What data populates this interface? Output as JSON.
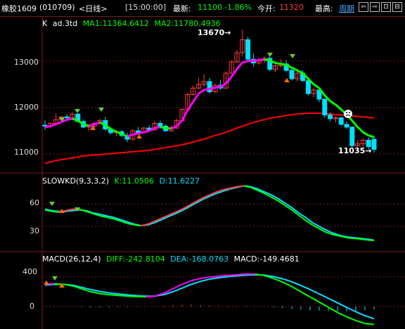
{
  "header": {
    "symbol": "橡胶1609",
    "code": "(010709)",
    "period": "<日线>",
    "time": "[15:00:00]",
    "latest_label": "最新:",
    "latest_value": "11100",
    "change_pct": "-1.86%",
    "open_label": "今开:",
    "open_value": "11320",
    "high_label": "最高:",
    "cycle_link": "周期",
    "buttons": [
      "⇦",
      "⇨",
      "⊡",
      "⊟"
    ]
  },
  "colors": {
    "up": "#ff3b3b",
    "down": "#00e0ff",
    "ma1": "#00ff00",
    "ma2": "#ff0000",
    "accent_magenta": "#ff00ff",
    "divider": "#7a1a1a"
  },
  "main_panel": {
    "label_k": "K",
    "label_ad": "ad.3td",
    "ma1": "MA1:11364.6412",
    "ma2": "MA2:11780.4936",
    "high_annotation": "13670",
    "low_annotation": "11035",
    "y_ticks": [
      "13000",
      "12000",
      "11000"
    ]
  },
  "kd_panel": {
    "label": "SLOWKD(9,3,3,2)",
    "k": "K:11.0506",
    "d": "D:11.6227",
    "y_ticks": [
      "60",
      "30"
    ]
  },
  "macd_panel": {
    "label": "MACD(26,12,4)",
    "diff": "DIFF:-242.8104",
    "dea": "DEA:-168.0763",
    "macd": "MACD:-149.4681",
    "y_ticks": [
      "400",
      "0"
    ]
  },
  "chart_data": {
    "type": "line",
    "candles": [
      [
        11620,
        11720,
        11520,
        11600
      ],
      [
        11600,
        11680,
        11560,
        11660
      ],
      [
        11660,
        11880,
        11640,
        11740
      ],
      [
        11740,
        11820,
        11700,
        11800
      ],
      [
        11800,
        11860,
        11720,
        11780
      ],
      [
        11780,
        11900,
        11760,
        11860
      ],
      [
        11860,
        11880,
        11680,
        11700
      ],
      [
        11700,
        11740,
        11560,
        11580
      ],
      [
        11580,
        11640,
        11500,
        11600
      ],
      [
        11600,
        11700,
        11560,
        11660
      ],
      [
        11660,
        11760,
        11640,
        11720
      ],
      [
        11720,
        11800,
        11500,
        11540
      ],
      [
        11540,
        11580,
        11420,
        11460
      ],
      [
        11460,
        11520,
        11380,
        11480
      ],
      [
        11480,
        11520,
        11360,
        11400
      ],
      [
        11400,
        11460,
        11260,
        11320
      ],
      [
        11320,
        11540,
        11300,
        11500
      ],
      [
        11500,
        11580,
        11420,
        11460
      ],
      [
        11460,
        11580,
        11440,
        11560
      ],
      [
        11560,
        11620,
        11500,
        11520
      ],
      [
        11520,
        11700,
        11500,
        11660
      ],
      [
        11660,
        11720,
        11560,
        11600
      ],
      [
        11600,
        11640,
        11480,
        11500
      ],
      [
        11500,
        11620,
        11480,
        11560
      ],
      [
        11560,
        11760,
        11540,
        11720
      ],
      [
        11720,
        11980,
        11700,
        11960
      ],
      [
        11960,
        12320,
        11940,
        12280
      ],
      [
        12280,
        12480,
        12260,
        12420
      ],
      [
        12420,
        12640,
        12380,
        12500
      ],
      [
        12500,
        12720,
        12440,
        12560
      ],
      [
        12560,
        12640,
        12300,
        12340
      ],
      [
        12340,
        12520,
        12320,
        12480
      ],
      [
        12480,
        12600,
        12380,
        12420
      ],
      [
        12420,
        12780,
        12400,
        12740
      ],
      [
        12740,
        13020,
        12720,
        12980
      ],
      [
        12980,
        13240,
        12960,
        13180
      ],
      [
        13180,
        13670,
        13100,
        13460
      ],
      [
        13460,
        13520,
        12980,
        13040
      ],
      [
        13040,
        13160,
        12880,
        12960
      ],
      [
        12960,
        13080,
        12920,
        13020
      ],
      [
        13020,
        13100,
        12960,
        13060
      ],
      [
        13060,
        13100,
        12780,
        12820
      ],
      [
        12820,
        12960,
        12760,
        12900
      ],
      [
        12900,
        13040,
        12860,
        12940
      ],
      [
        12940,
        13020,
        12760,
        12800
      ],
      [
        12800,
        12860,
        12580,
        12620
      ],
      [
        12620,
        12780,
        12560,
        12740
      ],
      [
        12740,
        12800,
        12560,
        12580
      ],
      [
        12580,
        12620,
        12260,
        12300
      ],
      [
        12300,
        12440,
        12220,
        12380
      ],
      [
        12380,
        12420,
        12120,
        12180
      ],
      [
        12180,
        12200,
        11780,
        11840
      ],
      [
        11840,
        11900,
        11700,
        11760
      ],
      [
        11760,
        11820,
        11680,
        11780
      ],
      [
        11780,
        11800,
        11600,
        11640
      ],
      [
        11640,
        11700,
        11540,
        11580
      ],
      [
        11580,
        11600,
        11120,
        11180
      ],
      [
        11180,
        11300,
        11060,
        11220
      ],
      [
        11220,
        11340,
        11160,
        11300
      ],
      [
        11300,
        11360,
        11100,
        11160
      ],
      [
        11320,
        11380,
        11035,
        11100
      ]
    ],
    "ma1": [
      11580,
      11600,
      11640,
      11690,
      11740,
      11760,
      11720,
      11640,
      11610,
      11640,
      11680,
      11620,
      11540,
      11480,
      11430,
      11380,
      11420,
      11440,
      11470,
      11500,
      11560,
      11580,
      11560,
      11550,
      11600,
      11720,
      11940,
      12120,
      12300,
      12380,
      12400,
      12430,
      12450,
      12520,
      12660,
      12830,
      12970,
      13000,
      13010,
      13020,
      13030,
      13020,
      12960,
      12940,
      12920,
      12860,
      12800,
      12740,
      12620,
      12500,
      12420,
      12260,
      12140,
      12060,
      11960,
      11850,
      11720,
      11580,
      11470,
      11400,
      11365
    ],
    "ma2": [
      10800,
      10830,
      10860,
      10880,
      10900,
      10920,
      10940,
      10960,
      10970,
      10980,
      10990,
      11000,
      11010,
      11020,
      11030,
      11040,
      11050,
      11060,
      11070,
      11080,
      11100,
      11120,
      11140,
      11160,
      11180,
      11200,
      11230,
      11260,
      11290,
      11320,
      11360,
      11400,
      11430,
      11470,
      11510,
      11560,
      11600,
      11640,
      11680,
      11710,
      11740,
      11770,
      11790,
      11810,
      11830,
      11850,
      11860,
      11870,
      11880,
      11880,
      11880,
      11870,
      11860,
      11850,
      11840,
      11830,
      11820,
      11810,
      11800,
      11790,
      11780
    ],
    "kd_k": [
      52,
      50,
      49,
      51,
      53,
      53,
      50,
      47,
      44,
      42,
      40,
      37,
      34,
      32,
      31,
      33,
      37,
      41,
      45,
      49,
      53,
      58,
      63,
      68,
      72,
      76,
      79,
      81,
      83,
      84,
      82,
      78,
      74,
      69,
      64,
      58,
      52,
      45,
      38,
      32,
      27,
      22,
      19,
      17,
      15,
      14,
      13,
      12,
      11.05
    ],
    "kd_d": [
      53,
      51,
      50,
      50,
      51,
      52,
      51,
      48,
      46,
      44,
      42,
      39,
      36,
      33,
      31,
      32,
      35,
      39,
      43,
      47,
      51,
      56,
      61,
      66,
      70,
      74,
      77,
      80,
      82,
      84,
      83,
      80,
      76,
      72,
      67,
      61,
      55,
      48,
      42,
      35,
      30,
      25,
      21,
      18,
      16,
      15,
      14,
      13,
      11.62
    ],
    "macd_diff": [
      300,
      310,
      300,
      280,
      240,
      200,
      175,
      160,
      150,
      140,
      135,
      130,
      140,
      180,
      240,
      300,
      350,
      380,
      400,
      410,
      420,
      430,
      440,
      440,
      420,
      380,
      330,
      270,
      200,
      130,
      60,
      -10,
      -80,
      -140,
      -190,
      -230,
      -243
    ],
    "macd_dea": [
      290,
      300,
      300,
      290,
      260,
      230,
      205,
      185,
      170,
      158,
      148,
      140,
      140,
      160,
      200,
      250,
      300,
      340,
      370,
      390,
      405,
      415,
      425,
      430,
      425,
      405,
      375,
      335,
      285,
      230,
      170,
      110,
      50,
      -10,
      -70,
      -125,
      -168
    ],
    "macd_hist": [
      20,
      15,
      5,
      -10,
      -30,
      -45,
      -50,
      -45,
      -35,
      -25,
      -15,
      -10,
      0,
      40,
      80,
      100,
      110,
      80,
      60,
      40,
      30,
      30,
      30,
      20,
      -10,
      -50,
      -90,
      -130,
      -170,
      -200,
      -220,
      -240,
      -260,
      -260,
      -240,
      -210,
      -150
    ]
  }
}
